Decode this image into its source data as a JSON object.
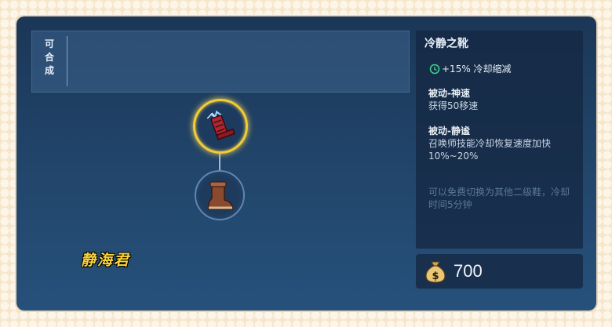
{
  "craft": {
    "label_chars": [
      "可",
      "合",
      "成"
    ]
  },
  "item": {
    "name": "冷静之靴",
    "stat": "+15% 冷却缩减",
    "stat_icon": "cooldown-icon",
    "passives": [
      {
        "name": "被动-神速",
        "desc": "获得50移速"
      },
      {
        "name": "被动-静谧",
        "desc": "召唤师技能冷却恢复速度加快 10%~20%"
      }
    ],
    "note": "可以免费切换为其他二级鞋，冷却时间5分钟",
    "price": "700",
    "price_icon": "money-bag-icon"
  },
  "tree": {
    "upgraded_icon": "advanced-boots-icon",
    "base_icon": "basic-boots-icon"
  },
  "watermark": "静海君",
  "colors": {
    "accent_gold": "#f0cc3a",
    "stat_green": "#3fd38a",
    "panel_blue": "#1b3757"
  }
}
